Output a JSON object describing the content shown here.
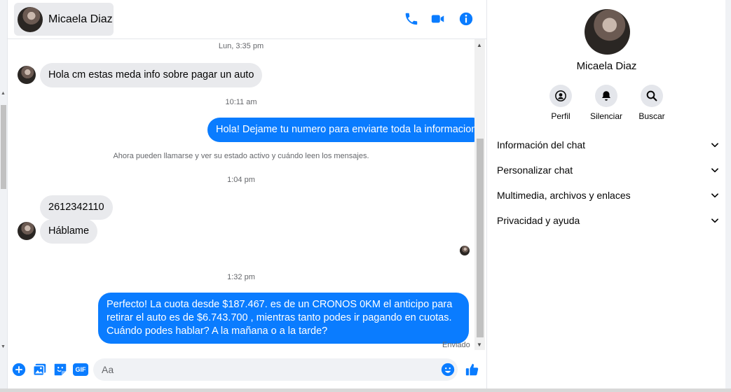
{
  "header": {
    "contact_name": "Micaela Diaz"
  },
  "messages": {
    "timestamps": [
      "Lun, 3:35 pm",
      "10:11 am",
      "1:04 pm",
      "1:32 pm"
    ],
    "incoming_1": "Hola cm estas meda info sobre pagar un auto",
    "outgoing_1": "Hola! Dejame tu numero  para enviarte toda la informacion",
    "system_note": "Ahora pueden llamarse y ver su estado activo y cuándo leen los mensajes.",
    "incoming_2": "2612342110",
    "incoming_3": "Háblame",
    "outgoing_2": "Perfecto! La cuota desde $187.467. es de un CRONOS 0KM el anticipo para retirar el auto es de $6.743.700 , mientras tanto podes ir pagando en cuotas. Cuándo podes hablar? A la mañana o a la tarde?",
    "sent_status": "Enviado"
  },
  "composer": {
    "placeholder": "Aa",
    "gif_label": "GIF"
  },
  "panel": {
    "name": "Micaela Diaz",
    "actions": {
      "profile": "Perfil",
      "mute": "Silenciar",
      "search": "Buscar"
    },
    "sections": [
      "Información del chat",
      "Personalizar chat",
      "Multimedia, archivos y enlaces",
      "Privacidad y ayuda"
    ]
  },
  "colors": {
    "accent": "#0a7cff",
    "incoming_bubble": "#e9eaed",
    "muted_text": "#65676b"
  }
}
